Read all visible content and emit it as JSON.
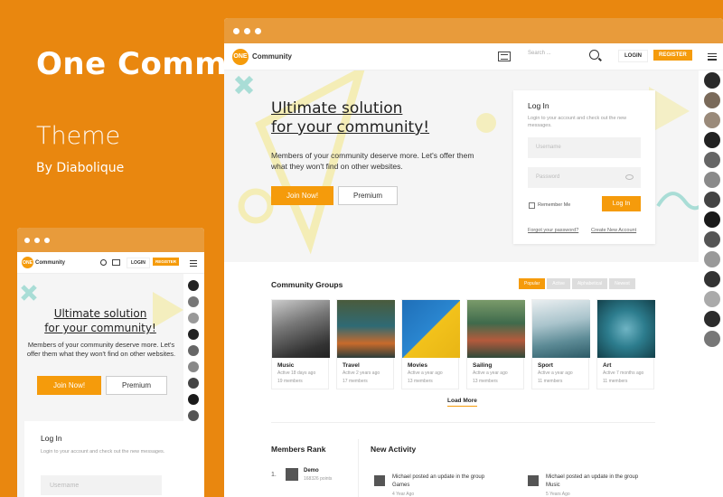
{
  "promo": {
    "title": "One Communit..",
    "subtitle": "Theme",
    "author": "By Diabolique"
  },
  "brand": {
    "logo_badge": "ONE",
    "logo_text": "Community",
    "accent_color": "#F59B0B",
    "background_color": "#E9870F"
  },
  "header": {
    "search_placeholder": "Search ...",
    "login_label": "LOGIN",
    "register_label": "REGISTER",
    "icons": [
      "newspaper-icon",
      "search-icon",
      "hamburger-menu-icon"
    ]
  },
  "hero": {
    "headline_line1": "Ultimate solution",
    "headline_line2": "for your community!",
    "description": "Members of your community deserve more. Let's offer them what they won't find on other websites.",
    "join_label": "Join Now!",
    "premium_label": "Premium"
  },
  "login_card": {
    "title": "Log In",
    "subtitle": "Login to your account and check out the new messages.",
    "username_placeholder": "Username",
    "password_placeholder": "Password",
    "remember_label": "Remember Me",
    "submit_label": "Log In",
    "forgot_label": "Forgot your password?",
    "create_label": "Create New Account"
  },
  "groups": {
    "title": "Community Groups",
    "tabs": [
      {
        "label": "Popular",
        "active": true
      },
      {
        "label": "Active",
        "active": false
      },
      {
        "label": "Alphabetical",
        "active": false
      },
      {
        "label": "Newest",
        "active": false
      }
    ],
    "items": [
      {
        "name": "Music",
        "active": "Active 18 days ago",
        "members": "19 members"
      },
      {
        "name": "Travel",
        "active": "Active 2 years ago",
        "members": "17 members"
      },
      {
        "name": "Movies",
        "active": "Active a year ago",
        "members": "13 members"
      },
      {
        "name": "Sailing",
        "active": "Active a year ago",
        "members": "13 members"
      },
      {
        "name": "Sport",
        "active": "Active a year ago",
        "members": "11 members"
      },
      {
        "name": "Art",
        "active": "Active 7 months ago",
        "members": "11 members"
      }
    ],
    "load_more": "Load More"
  },
  "members_rank": {
    "title": "Members Rank",
    "items": [
      {
        "rank": "1.",
        "name": "Demo",
        "points": "168326 points"
      }
    ]
  },
  "activity": {
    "title": "New Activity",
    "items": [
      {
        "text_line1": "Michael posted an update in the group",
        "text_line2": "Games",
        "time": "4 Year Ago"
      },
      {
        "text_line1": "Michael posted an update in the group",
        "text_line2": "Music",
        "time": "5 Years Ago"
      }
    ]
  }
}
